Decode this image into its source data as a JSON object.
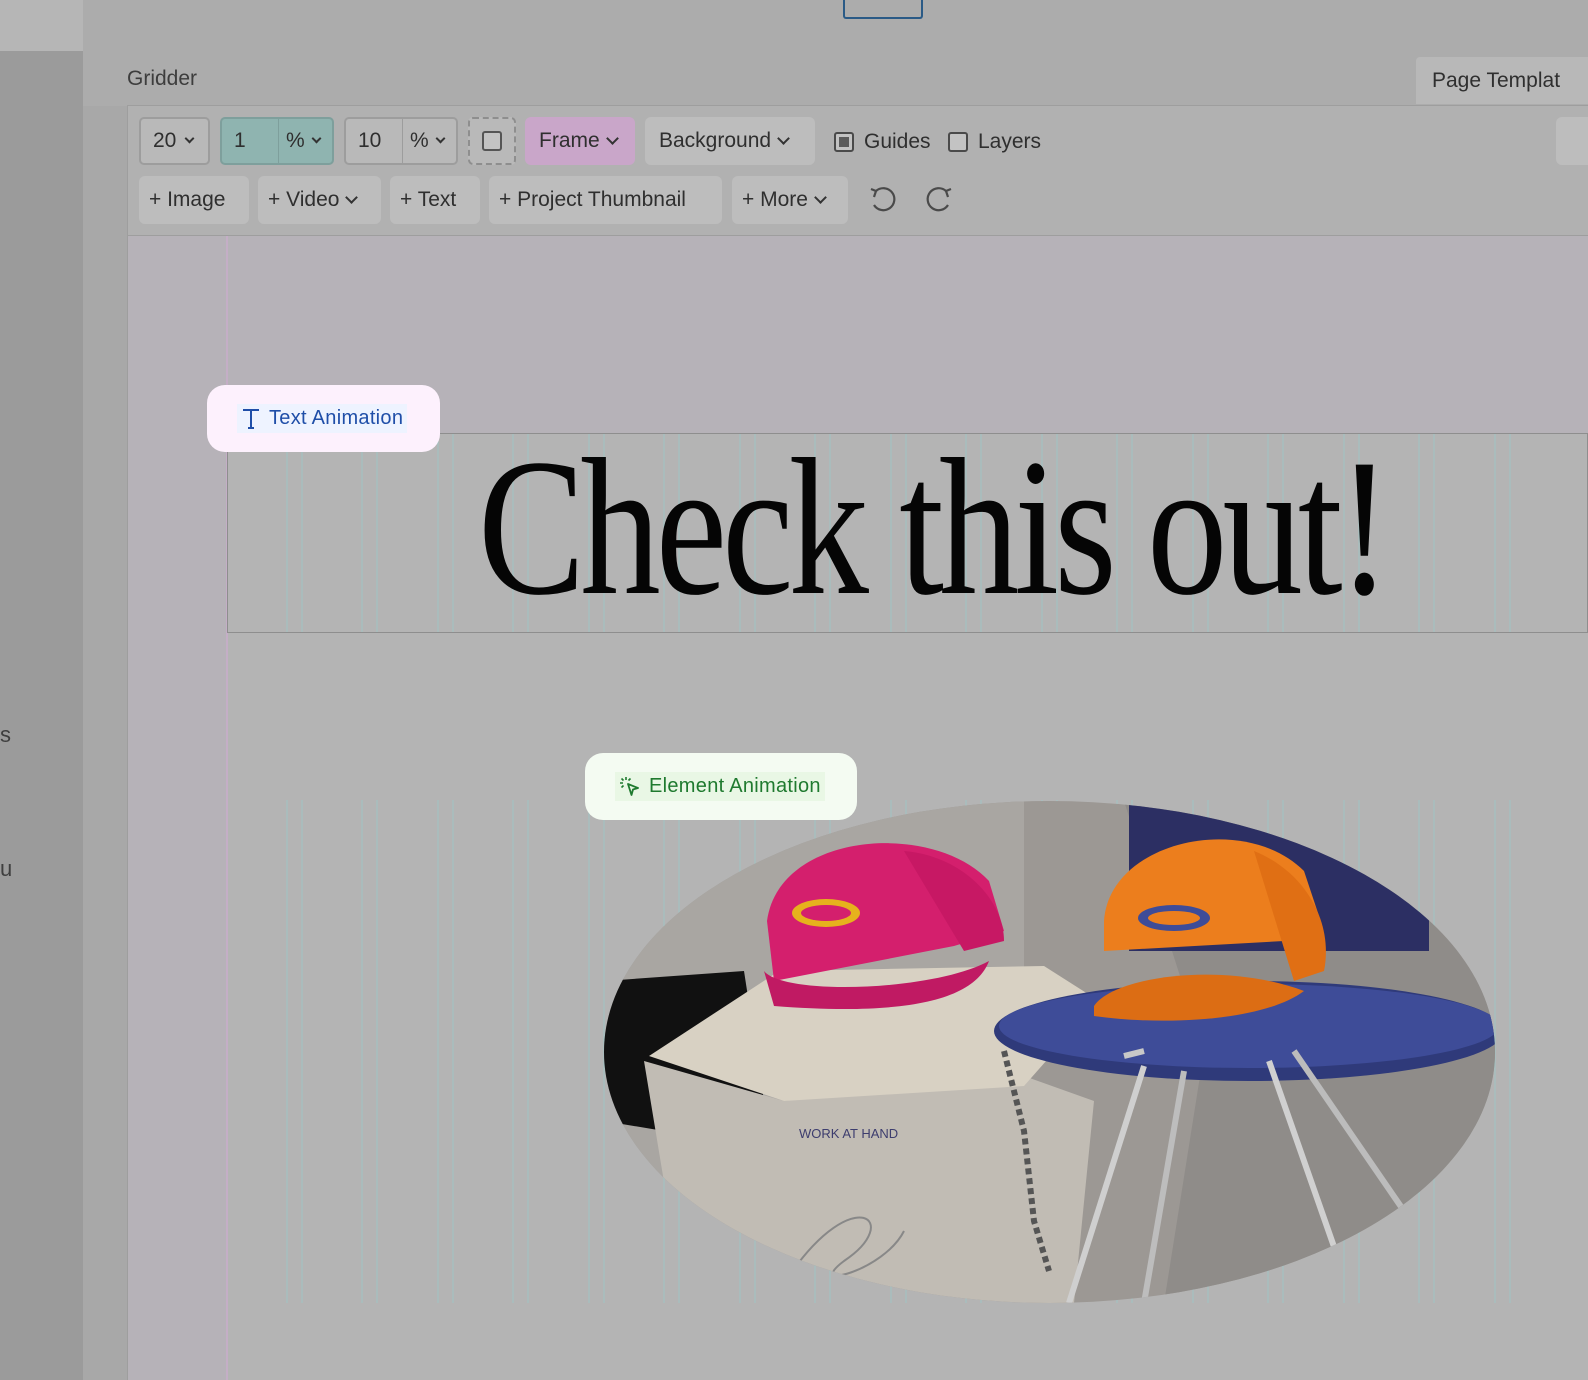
{
  "left_rail": {
    "fragments": [
      "s",
      "u"
    ]
  },
  "header": {
    "section_title": "Gridder",
    "page_templates_label": "Page Templat"
  },
  "toolbar": {
    "columns": {
      "value": "20"
    },
    "gutter": {
      "value": "1",
      "unit": "%"
    },
    "margin": {
      "value": "10",
      "unit": "%"
    },
    "frame_label": "Frame",
    "background_label": "Background",
    "guides": {
      "label": "Guides",
      "checked": true
    },
    "layers": {
      "label": "Layers",
      "checked": false
    },
    "add_buttons": [
      "+ Image",
      "+ Video",
      "+ Text",
      "+ Project Thumbnail",
      "+ More"
    ],
    "undo_icon": "undo-icon",
    "redo_icon": "redo-icon"
  },
  "canvas": {
    "text_animation_label": "Text Animation",
    "element_animation_label": "Element Animation",
    "headline": "Check this out!",
    "photo_label": "WORK AT HAND"
  },
  "colors": {
    "text_tag_bg": "#fdf1fd",
    "text_tag_fg": "#1f4ea8",
    "element_tag_bg": "#f4fbf2",
    "element_tag_fg": "#1f7a2f",
    "frame_button": "#c9a6c9",
    "gutter_field": "#8fb4b0",
    "grid_line": "#9ec9c9"
  }
}
